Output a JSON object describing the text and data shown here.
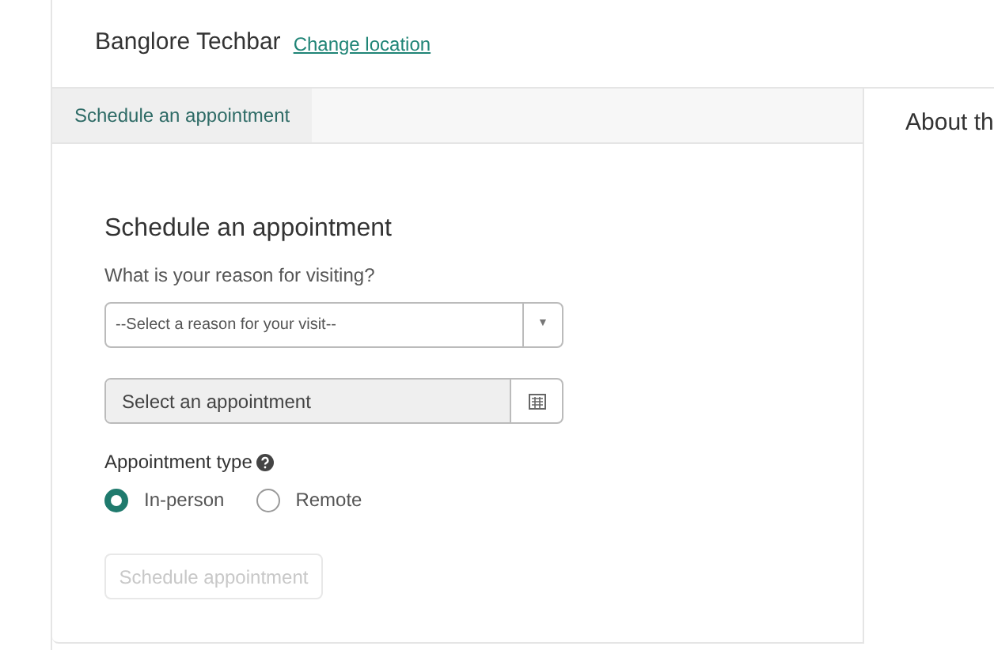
{
  "header": {
    "location": "Banglore Techbar",
    "change_link": "Change location"
  },
  "tabs": [
    {
      "label": "Schedule an appointment",
      "selected": true
    }
  ],
  "form": {
    "title": "Schedule an appointment",
    "reason_label": "What is your reason for visiting?",
    "reason_select": {
      "value": "--Select a reason for your visit--",
      "arrow": "▼"
    },
    "appointment_field": {
      "placeholder": "Select an appointment"
    },
    "type_label": "Appointment type",
    "types": [
      {
        "label": "In-person",
        "selected": true
      },
      {
        "label": "Remote",
        "selected": false
      }
    ],
    "submit": {
      "label": "Schedule appointment",
      "disabled": true
    }
  },
  "side_panel": {
    "title": "About th"
  }
}
